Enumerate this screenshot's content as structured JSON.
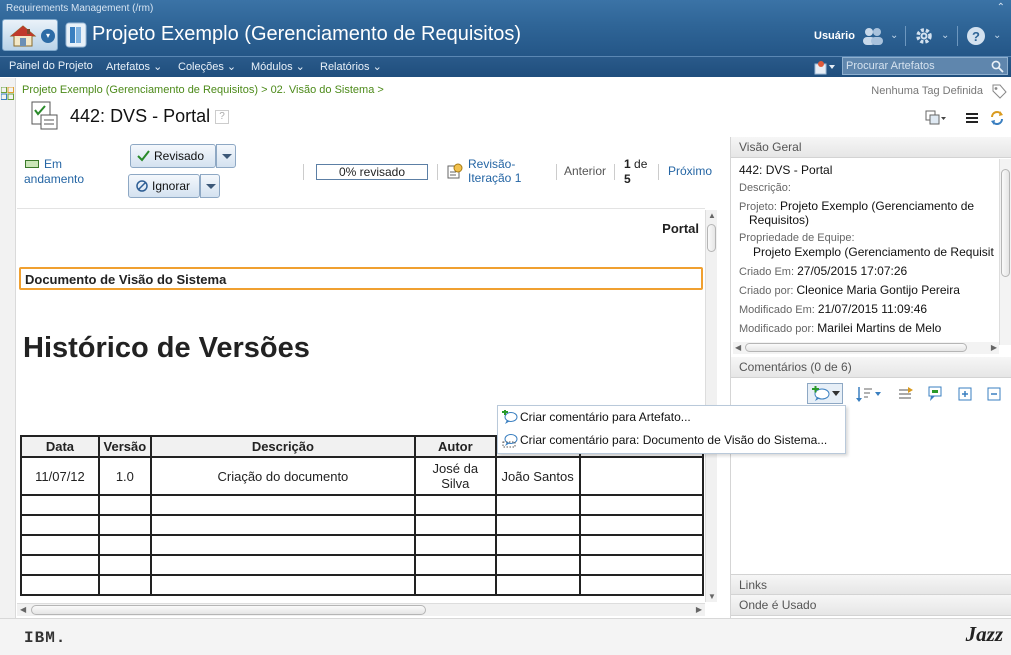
{
  "app": {
    "system_name": "Requirements Management (/rm)",
    "project_title": "Projeto Exemplo (Gerenciamento de Requisitos)",
    "user_label": "Usuário"
  },
  "nav": {
    "items": [
      "Painel do Projeto",
      "Artefatos",
      "Coleções",
      "Módulos",
      "Relatórios"
    ],
    "search_placeholder": "Procurar Artefatos"
  },
  "breadcrumb": {
    "project": "Projeto Exemplo (Gerenciamento de Requisitos)",
    "sep1": " > ",
    "folder": "02. Visão do Sistema",
    "sep2": " >"
  },
  "artifact": {
    "id": "442:",
    "name": "DVS - Portal",
    "tag_status": "Nenhuma Tag Definida",
    "help": "?"
  },
  "toolbar": {
    "status": "Em andamento",
    "reviewed_label": "Revisado",
    "ignore_label": "Ignorar",
    "progress_text": "0% revisado",
    "progress_fraction": 0,
    "review_link": "Revisão-Iteração 1",
    "previous_label": "Anterior",
    "page_current": "1",
    "page_of": "de",
    "page_total": "5",
    "next_label": "Próximo"
  },
  "document": {
    "portal": "Portal",
    "section_title": "Documento de Visão do Sistema",
    "heading": "Histórico de Versões",
    "table": {
      "headers": [
        "Data",
        "Versão",
        "Descrição",
        "Autor",
        "",
        ""
      ],
      "rows": [
        [
          "11/07/12",
          "1.0",
          "Criação do documento",
          "José da Silva",
          "João Santos",
          ""
        ]
      ]
    }
  },
  "overview": {
    "header": "Visão Geral",
    "title_line": "442: DVS - Portal",
    "description_label": "Descrição:",
    "project_label": "Projeto:",
    "project_value": "Projeto Exemplo (Gerenciamento de",
    "project_value2": "Requisitos)",
    "team_label": "Propriedade de Equipe:",
    "team_value": "Projeto Exemplo (Gerenciamento de Requisit",
    "created_on_label": "Criado Em:",
    "created_on_value": "27/05/2015 17:07:26",
    "created_by_label": "Criado por:",
    "created_by_value": "Cleonice Maria Gontijo Pereira",
    "modified_on_label": "Modificado Em:",
    "modified_on_value": "21/07/2015 11:09:46",
    "modified_by_label": "Modificado por:",
    "modified_by_value": "Marilei Martins de Melo"
  },
  "panels": {
    "comments_header": "Comentários (0 de 6)",
    "links_header": "Links",
    "where_used_header": "Onde é Usado"
  },
  "popup_menu": {
    "items": [
      "Criar comentário para Artefato...",
      "Criar comentário para: Documento de Visão do Sistema..."
    ]
  },
  "footer": {
    "left_logo": "IBM.",
    "right_logo": "Jazz"
  },
  "colors": {
    "banner": "#2f6597",
    "link": "#2465a4",
    "breadcrumb": "#4c8a19",
    "highlight_border": "#f0a030"
  }
}
